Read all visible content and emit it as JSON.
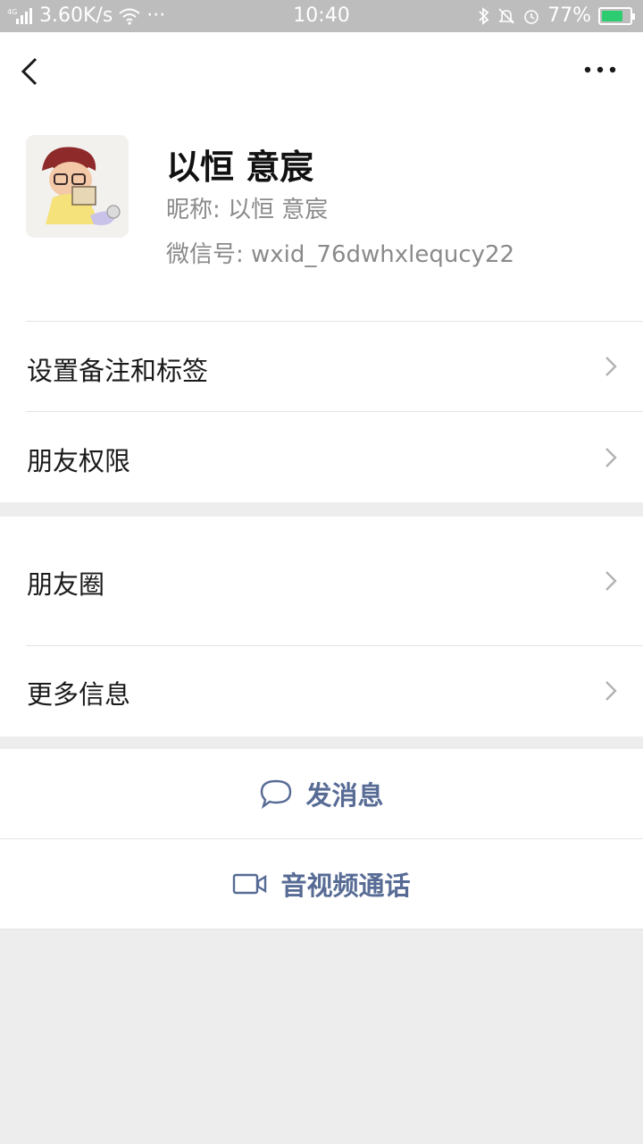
{
  "status_bar": {
    "network": "4G",
    "speed": "3.60K/s",
    "more": "···",
    "time": "10:40",
    "battery": "77%",
    "battery_level": 0.77,
    "battery_color": "#2ecc71"
  },
  "header": {
    "back_icon": "chevron-left-icon",
    "more_icon": "more-dots-icon"
  },
  "profile": {
    "name": "以恒 意宸",
    "nickname": "昵称:  以恒 意宸",
    "wechat_id": "微信号:  wxid_76dwhxlequcy22"
  },
  "menu": {
    "remark_tags": "设置备注和标签",
    "permissions": "朋友权限",
    "moments": "朋友圈",
    "more_info": "更多信息"
  },
  "actions": {
    "message": "发消息",
    "video_call": "音视频通话",
    "accent_color": "#576b95"
  }
}
